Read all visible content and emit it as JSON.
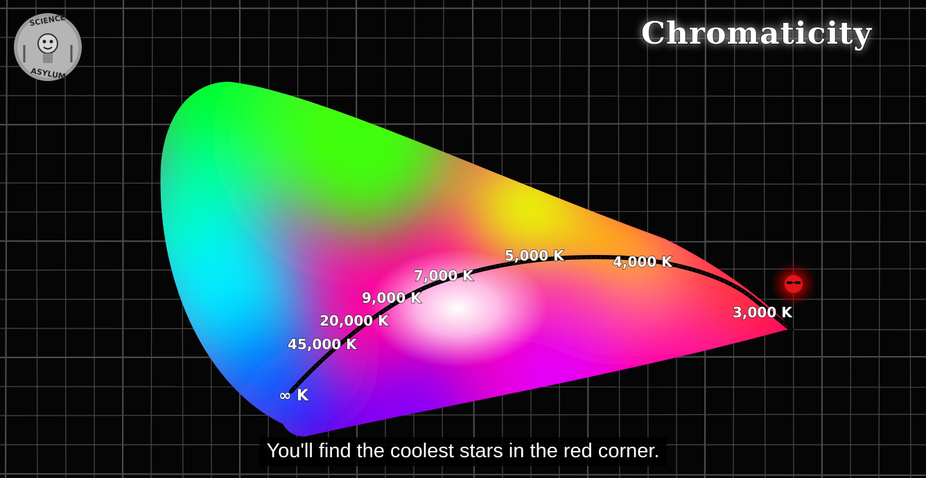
{
  "title": "Chromaticity",
  "logo": {
    "top_text": "SCIENCE",
    "bottom_text": "ASYLUM"
  },
  "temperature_labels": [
    {
      "id": "inf",
      "text": "∞ K"
    },
    {
      "id": "45000",
      "text": "45,000 K"
    },
    {
      "id": "20000",
      "text": "20,000 K"
    },
    {
      "id": "9000",
      "text": "9,000 K"
    },
    {
      "id": "7000",
      "text": "7,000 K"
    },
    {
      "id": "5000",
      "text": "5,000 K"
    },
    {
      "id": "4000",
      "text": "4,000 K"
    },
    {
      "id": "3000",
      "text": "3,000 K"
    }
  ],
  "caption": "You'll find the coolest stars in the red corner.",
  "colors": {
    "background": "#050505",
    "grid": "#4a4a4a",
    "locus": "#000000",
    "star": "#e0141a"
  },
  "icons": {
    "star_marker": "red-star-face-icon",
    "logo": "science-asylum-logo-icon"
  }
}
